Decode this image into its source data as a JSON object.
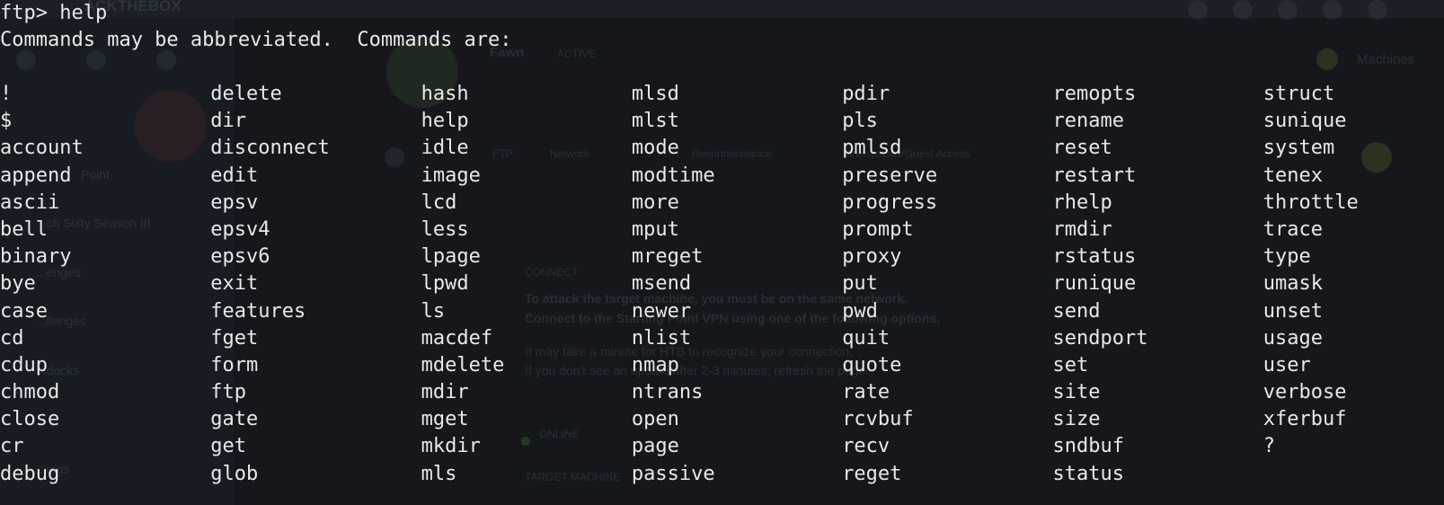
{
  "terminal": {
    "prompt_line": "ftp> help",
    "header_line": "Commands may be abbreviated.  Commands are:",
    "commands": [
      [
        "!",
        "delete",
        "hash",
        "mlsd",
        "pdir",
        "remopts",
        "struct"
      ],
      [
        "$",
        "dir",
        "help",
        "mlst",
        "pls",
        "rename",
        "sunique"
      ],
      [
        "account",
        "disconnect",
        "idle",
        "mode",
        "pmlsd",
        "reset",
        "system"
      ],
      [
        "append",
        "edit",
        "image",
        "modtime",
        "preserve",
        "restart",
        "tenex"
      ],
      [
        "ascii",
        "epsv",
        "lcd",
        "more",
        "progress",
        "rhelp",
        "throttle"
      ],
      [
        "bell",
        "epsv4",
        "less",
        "mput",
        "prompt",
        "rmdir",
        "trace"
      ],
      [
        "binary",
        "epsv6",
        "lpage",
        "mreget",
        "proxy",
        "rstatus",
        "type"
      ],
      [
        "bye",
        "exit",
        "lpwd",
        "msend",
        "put",
        "runique",
        "umask"
      ],
      [
        "case",
        "features",
        "ls",
        "newer",
        "pwd",
        "send",
        "unset"
      ],
      [
        "cd",
        "fget",
        "macdef",
        "nlist",
        "quit",
        "sendport",
        "usage"
      ],
      [
        "cdup",
        "form",
        "mdelete",
        "nmap",
        "quote",
        "set",
        "user"
      ],
      [
        "chmod",
        "ftp",
        "mdir",
        "ntrans",
        "rate",
        "site",
        "verbose"
      ],
      [
        "close",
        "gate",
        "mget",
        "open",
        "rcvbuf",
        "size",
        "xferbuf"
      ],
      [
        "cr",
        "get",
        "mkdir",
        "page",
        "recv",
        "sndbuf",
        "?"
      ],
      [
        "debug",
        "glob",
        "mls",
        "passive",
        "reget",
        "status",
        ""
      ]
    ]
  },
  "background": {
    "brand": "ACKTHEBOX",
    "machine_name": "Fawn",
    "machine_status": "ACTIVE",
    "machines_label": "Machines",
    "tags": [
      "FTP",
      "Network",
      "Reconnaissance",
      "Anonymous/Guest Access"
    ],
    "sidebar_items": [
      "Point",
      "...ch Sixty Season III",
      "...enges",
      "...llenges",
      "...docks",
      "...ings"
    ],
    "connect_heading": "CONNECT",
    "connect_text_1": "To attack the target machine, you must be on the same network.",
    "connect_text_2": "Connect to the Starting Point VPN using one of the following options.",
    "connect_text_3": "It may take a minute for HTB to recognize your connection.",
    "connect_text_4": "If you don't see an update after 2-3 minutes, refresh the page.",
    "online_label": "ONLINE",
    "target_label": "TARGET MACHINE"
  }
}
